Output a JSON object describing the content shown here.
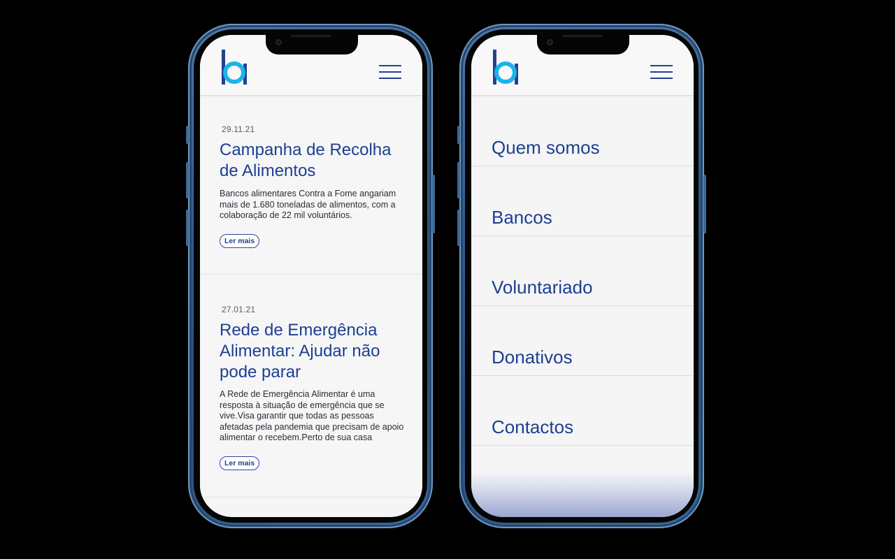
{
  "brand": {
    "logo_letter": "b",
    "accent_blue": "#1d3f91",
    "logo_cyan": "#19b4ea"
  },
  "left_screen": {
    "menu_icon": "hamburger-menu-icon",
    "news": [
      {
        "date": "29.11.21",
        "title": "Campanha de Recolha de Alimentos",
        "excerpt": "Bancos alimentares Contra a Fome angariam mais de 1.680 toneladas de alimentos, com a colaboração de 22 mil voluntários.",
        "button": "Ler mais"
      },
      {
        "date": "27.01.21",
        "title": "Rede de Emergência Alimentar: Ajudar não pode parar",
        "excerpt": "A Rede de Emergência Alimentar é uma resposta à situação de emergência que se vive.Visa garantir que todas as pessoas afetadas pela pandemia que precisam de apoio alimentar o recebem.Perto de sua casa",
        "button": "Ler mais"
      }
    ]
  },
  "right_screen": {
    "menu_icon": "hamburger-menu-icon",
    "nav": [
      {
        "label": "Quem somos"
      },
      {
        "label": "Bancos"
      },
      {
        "label": "Voluntariado"
      },
      {
        "label": "Donativos"
      },
      {
        "label": "Contactos"
      }
    ]
  }
}
